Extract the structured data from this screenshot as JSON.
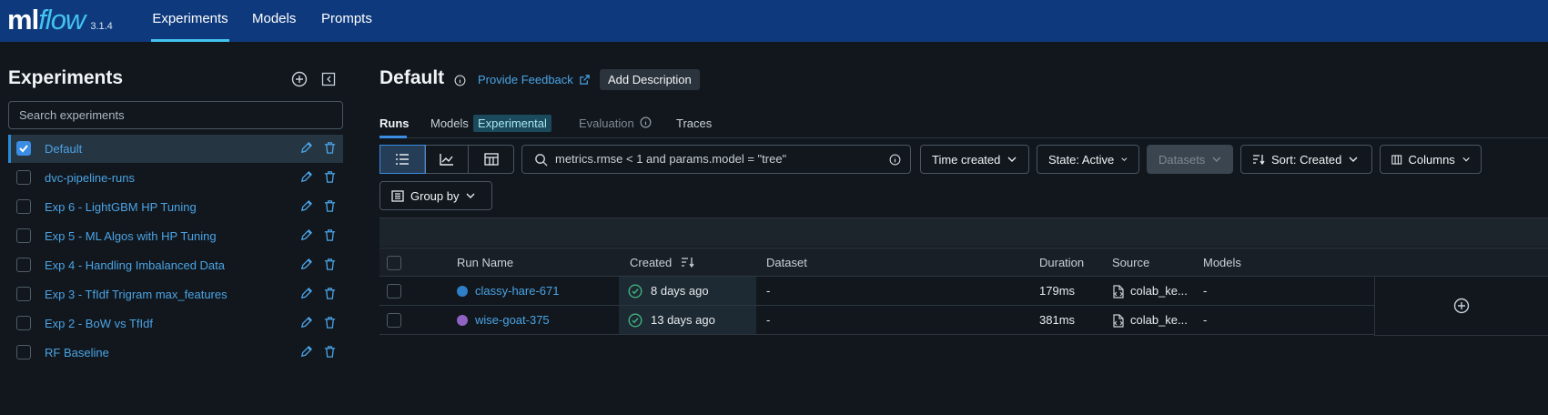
{
  "app": {
    "logo_ml": "ml",
    "logo_flow": "flow",
    "version": "3.1.4"
  },
  "nav": {
    "tabs": [
      "Experiments",
      "Models",
      "Prompts"
    ],
    "active": "Experiments"
  },
  "sidebar": {
    "title": "Experiments",
    "search_placeholder": "Search experiments",
    "experiments": [
      {
        "name": "Default",
        "selected": true
      },
      {
        "name": "dvc-pipeline-runs",
        "selected": false
      },
      {
        "name": "Exp 6 - LightGBM HP Tuning",
        "selected": false
      },
      {
        "name": "Exp 5 - ML Algos with HP Tuning",
        "selected": false
      },
      {
        "name": "Exp 4 - Handling Imbalanced Data",
        "selected": false
      },
      {
        "name": "Exp 3 - TfIdf Trigram max_features",
        "selected": false
      },
      {
        "name": "Exp 2 - BoW vs TfIdf",
        "selected": false
      },
      {
        "name": "RF Baseline",
        "selected": false
      }
    ]
  },
  "main": {
    "title": "Default",
    "feedback_link": "Provide Feedback",
    "add_description": "Add Description",
    "tabs": [
      {
        "label": "Runs",
        "active": true
      },
      {
        "label": "Models",
        "active": false
      },
      {
        "label": "Evaluation",
        "active": false
      },
      {
        "label": "Traces",
        "active": false
      }
    ],
    "models_badge": "Experimental",
    "search_query": "metrics.rmse < 1 and params.model = \"tree\"",
    "filters": {
      "time": "Time created",
      "state": "State: Active",
      "datasets": "Datasets",
      "sort": "Sort: Created",
      "columns": "Columns",
      "group_by": "Group by"
    }
  },
  "table": {
    "headers": [
      "Run Name",
      "Created",
      "Dataset",
      "Duration",
      "Source",
      "Models"
    ],
    "rows": [
      {
        "name": "classy-hare-671",
        "color": "#2e7fc7",
        "created": "8 days ago",
        "dataset": "-",
        "duration": "179ms",
        "source": "colab_ke...",
        "models": "-"
      },
      {
        "name": "wise-goat-375",
        "color": "#9062c4",
        "created": "13 days ago",
        "dataset": "-",
        "duration": "381ms",
        "source": "colab_ke...",
        "models": "-"
      }
    ]
  },
  "colors": {
    "accent": "#43c3f0",
    "link": "#4ba3e6",
    "topbar": "#0e3a7d",
    "background": "#11171c"
  }
}
